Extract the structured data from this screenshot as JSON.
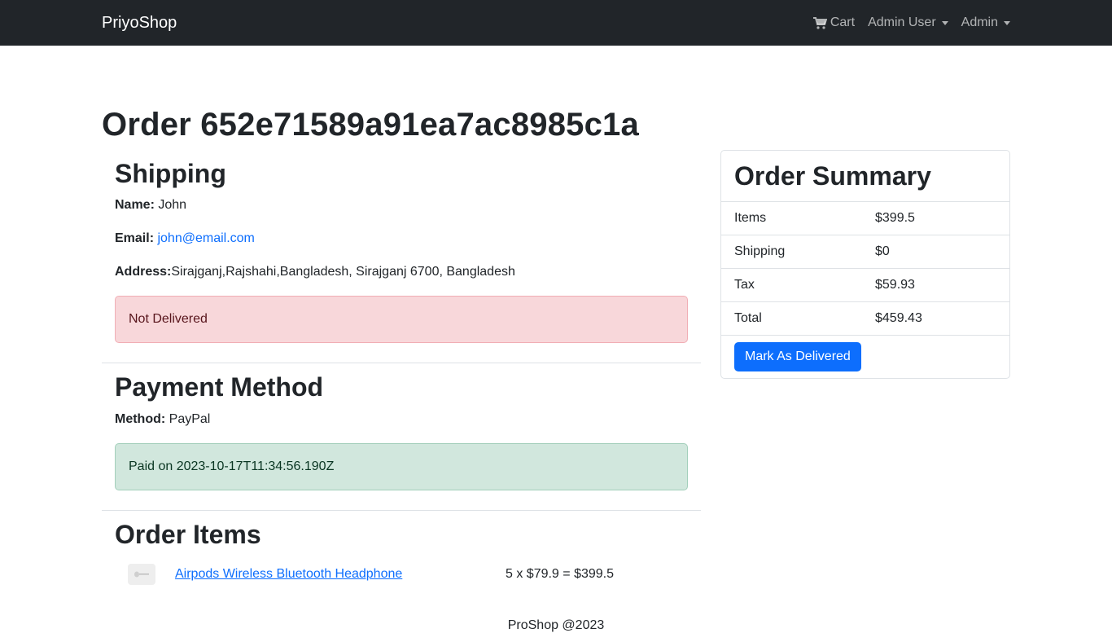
{
  "navbar": {
    "brand": "PriyoShop",
    "cart_label": "Cart",
    "user_menu_label": "Admin User",
    "admin_menu_label": "Admin"
  },
  "order": {
    "title": "Order 652e71589a91ea7ac8985c1a"
  },
  "shipping": {
    "heading": "Shipping",
    "name_label": "Name:",
    "name_value": "John",
    "email_label": "Email:",
    "email_value": "john@email.com",
    "address_label": "Address:",
    "address_value": "Sirajganj,Rajshahi,Bangladesh, Sirajganj 6700, Bangladesh",
    "status": "Not Delivered"
  },
  "payment": {
    "heading": "Payment Method",
    "method_label": "Method:",
    "method_value": "PayPal",
    "status": "Paid on 2023-10-17T11:34:56.190Z"
  },
  "items": {
    "heading": "Order Items",
    "list": [
      {
        "name": "Airpods Wireless Bluetooth Headphone",
        "calc": "5 x $79.9 = $399.5"
      }
    ]
  },
  "summary": {
    "heading": "Order Summary",
    "rows": [
      {
        "label": "Items",
        "value": "$399.5"
      },
      {
        "label": "Shipping",
        "value": "$0"
      },
      {
        "label": "Tax",
        "value": "$59.93"
      },
      {
        "label": "Total",
        "value": "$459.43"
      }
    ],
    "button_label": "Mark As Delivered"
  },
  "footer": {
    "text": "ProShop @2023"
  },
  "colors": {
    "navbar_bg": "#212529",
    "primary": "#0d6efd",
    "danger_bg": "#f8d7da",
    "success_bg": "#d1e7dd"
  }
}
